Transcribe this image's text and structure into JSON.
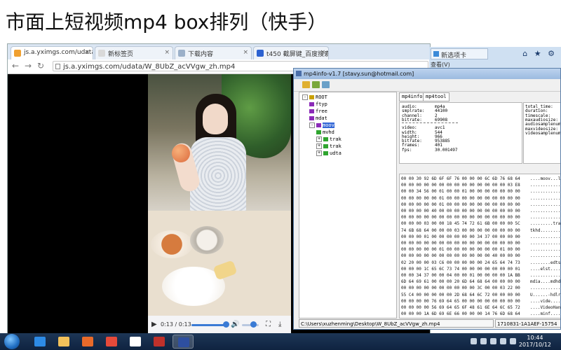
{
  "slide": {
    "title": "市面上短视频mp4 box排列（快手）"
  },
  "browser": {
    "tabs": [
      {
        "label": "js.a.yximgs.com/udata",
        "icon": "page-icon",
        "active": true
      },
      {
        "label": "新标签页",
        "icon": "page-icon",
        "active": false
      },
      {
        "label": "下载内容",
        "icon": "download-icon",
        "active": false
      },
      {
        "label": "t450 截屏键_百度搜索",
        "icon": "baidu-icon",
        "active": false
      }
    ],
    "url": "js.a.yximgs.com/udata/W_8UbZ_acVVgw_zh.mp4",
    "video": {
      "time": "0:13 / 0:13",
      "progress": 1.0,
      "volume": 0.7
    }
  },
  "ie_window": {
    "tab_label": "新选项卡",
    "subtext": "查看(V)",
    "buttons": "⌂ ★ ⚙"
  },
  "mp4info": {
    "title": "mp4info-v1.7 [stavy.sun@hotmail.com]",
    "tree": [
      {
        "label": "ROOT",
        "level": 0,
        "expander": "-",
        "color": "#c9a000"
      },
      {
        "label": "ftyp",
        "level": 1,
        "expander": "",
        "color": "#8b2bb8"
      },
      {
        "label": "free",
        "level": 1,
        "expander": "",
        "color": "#8b2bb8"
      },
      {
        "label": "mdat",
        "level": 1,
        "expander": "",
        "color": "#8b2bb8"
      },
      {
        "label": "moov",
        "level": 1,
        "expander": "-",
        "color": "#8b2bb8",
        "selected": true
      },
      {
        "label": "mvhd",
        "level": 2,
        "expander": "",
        "color": "#2fa52f"
      },
      {
        "label": "trak",
        "level": 2,
        "expander": "+",
        "color": "#2fa52f"
      },
      {
        "label": "trak",
        "level": 2,
        "expander": "+",
        "color": "#2fa52f"
      },
      {
        "label": "udta",
        "level": 2,
        "expander": "+",
        "color": "#2fa52f"
      }
    ],
    "tabs": [
      "mp4info",
      "mp4tool"
    ],
    "info_audio": [
      {
        "k": "audio:",
        "v": "mp4a"
      },
      {
        "k": "smplrate:",
        "v": "44100"
      },
      {
        "k": "channel:",
        "v": "2"
      },
      {
        "k": "bitrate:",
        "v": "69908"
      }
    ],
    "info_video": [
      {
        "k": "video:",
        "v": "avc1"
      },
      {
        "k": "width:",
        "v": "544"
      },
      {
        "k": "height:",
        "v": "966"
      },
      {
        "k": "bitrate:",
        "v": "953885"
      },
      {
        "k": "frames:",
        "v": "401"
      },
      {
        "k": "fps:",
        "v": "30.001497"
      }
    ],
    "info_right": [
      "total_time:",
      "duration:",
      "timescale:",
      "maxaudiosize:",
      "audiosamplenum:",
      "maxvideosize:",
      "videosamplenum:"
    ],
    "hex_rows": [
      {
        "hex": "00 00 30 92 6D 6F 6F 76   00 00 00 6C 6D 76 68 64",
        "asc": "....moov...l"
      },
      {
        "hex": "00 00 00 00 00 00 00 00   00 00 00 00 00 00 03 E8",
        "asc": "............"
      },
      {
        "hex": "00 00 34 56 00 01 00 00   01 00 00 00 00 00 00 00",
        "asc": "............"
      },
      {
        "hex": "00 00 00 00 00 01 00 00   00 00 00 00 00 00 00 00",
        "asc": "............"
      },
      {
        "hex": "00 00 00 00 00 01 00 00   00 00 00 00 00 00 00 00",
        "asc": "............"
      },
      {
        "hex": "00 00 00 00 40 00 00 00   00 00 00 00 00 00 00 00",
        "asc": "............"
      },
      {
        "hex": "00 00 00 00 00 00 00 00   00 00 00 00 00 00 00 00",
        "asc": "............"
      },
      {
        "hex": "00 00 00 03 00 00 18 45   74 72 61 6B 00 00 00 5C",
        "asc": ".........trak"
      },
      {
        "hex": "74 6B 68 64 00 00 00 03   00 00 00 00 00 00 00 00",
        "asc": "tkhd........"
      },
      {
        "hex": "00 00 00 01 00 00 00 00   00 00 34 37 00 00 00 00",
        "asc": "............"
      },
      {
        "hex": "00 00 00 00 00 00 00 00   00 00 00 00 00 00 00 00",
        "asc": "............"
      },
      {
        "hex": "00 00 00 00 00 01 00 00   00 00 00 00 00 01 00 00",
        "asc": "............"
      },
      {
        "hex": "00 00 00 00 00 00 00 00   00 00 00 00 40 00 00 00",
        "asc": "............"
      },
      {
        "hex": "02 20 00 00 03 C6 00 00   00 00 00 24 65 64 74 73",
        "asc": "........edts"
      },
      {
        "hex": "00 00 00 1C 65 6C 73 74   00 00 00 00 00 00 00 01",
        "asc": "....elst...."
      },
      {
        "hex": "00 00 34 37 00 00 04 00   00 01 00 00 00 00 1A BB",
        "asc": "............"
      },
      {
        "hex": "6D 64 69 61 00 00 00 20   6D 64 68 64 00 00 00 00",
        "asc": "mdia....mdhd"
      },
      {
        "hex": "00 00 00 00 00 00 00 00   00 00 3C 00 00 03 22 00",
        "asc": "............"
      },
      {
        "hex": "55 C4 00 00 00 00 00 2D   68 64 6C 72 00 00 00 00",
        "asc": "U......-hdlr"
      },
      {
        "hex": "00 00 00 00 76 69 64 65   00 00 00 00 00 00 00 00",
        "asc": "....vide...."
      },
      {
        "hex": "00 00 00 00 56 69 64 65   6F 48 61 6E 64 6C 65 72",
        "asc": "....VideoHandler"
      },
      {
        "hex": "00 00 00 1A 6D 69 6E 66   00 00 00 14 76 6D 68 64",
        "asc": "....minf...."
      }
    ],
    "status_path": "C:\\Users\\xuzhenming\\Desktop\\W_8UbZ_acVVgw_zh.mp4",
    "status_id": "1710831-1A1AEF-15754"
  },
  "taskbar": {
    "apps": [
      {
        "name": "ie",
        "color": "#2d8be6"
      },
      {
        "name": "explorer",
        "color": "#f1c15b"
      },
      {
        "name": "media-player",
        "color": "#e86a2a"
      },
      {
        "name": "chrome",
        "color": "#e64a3a"
      },
      {
        "name": "document",
        "color": "#ffffff"
      },
      {
        "name": "calculator",
        "color": "#c0312b"
      },
      {
        "name": "mp4info",
        "color": "#2e4fa0"
      }
    ],
    "time": "10:44",
    "date": "2017/10/12"
  }
}
